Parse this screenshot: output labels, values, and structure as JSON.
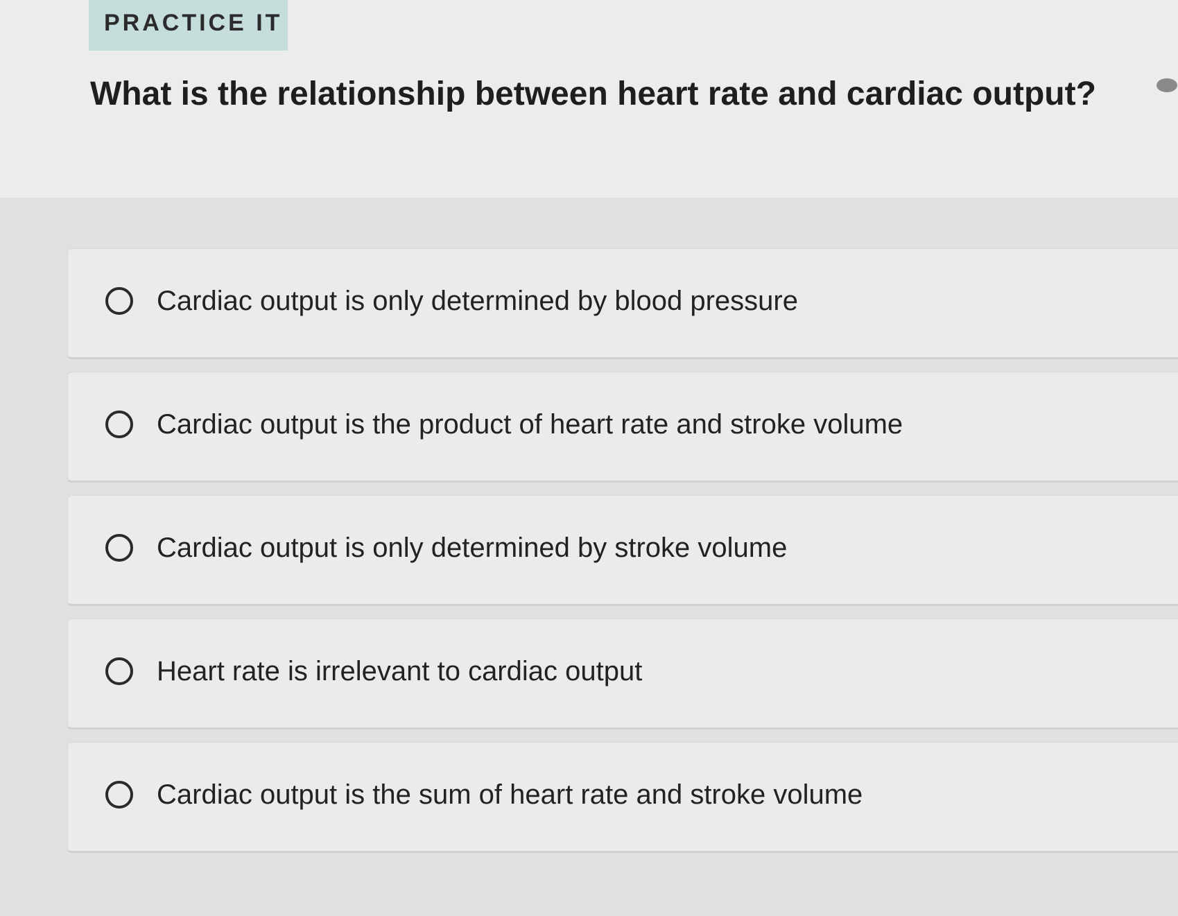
{
  "badge": {
    "label": "PRACTICE IT"
  },
  "question": {
    "text": "What is the relationship between heart rate and cardiac output?"
  },
  "options": [
    {
      "label": "Cardiac output is only determined by blood pressure",
      "selected": false
    },
    {
      "label": "Cardiac output is the product of heart rate and stroke volume",
      "selected": false
    },
    {
      "label": "Cardiac output is only determined by stroke volume",
      "selected": false
    },
    {
      "label": "Heart rate is irrelevant to cardiac output",
      "selected": false
    },
    {
      "label": "Cardiac output is the sum of heart rate and stroke volume",
      "selected": false
    }
  ]
}
